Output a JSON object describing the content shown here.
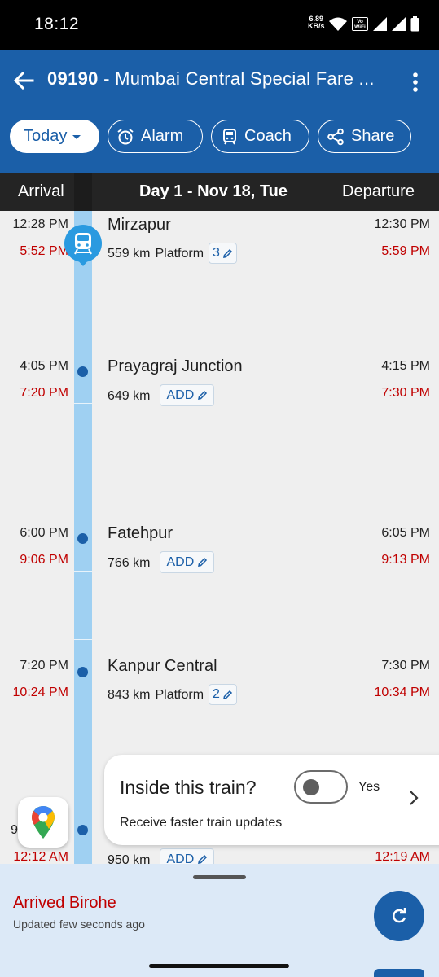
{
  "status_bar": {
    "time": "18:12",
    "speed_value": "6.89",
    "speed_unit": "KB/s",
    "vowifi_label": "Vo WiFi",
    "icons": [
      "wifi-icon",
      "vowifi-icon",
      "signal-icon",
      "battery-icon"
    ]
  },
  "app_bar": {
    "train_number": "09190",
    "title_rest": " - Mumbai Central Special Fare ...",
    "icons": [
      "back-arrow-icon",
      "more-vert-icon"
    ]
  },
  "chips": {
    "today": "Today",
    "alarm": "Alarm",
    "coach": "Coach",
    "share": "Share"
  },
  "header": {
    "arrival": "Arrival",
    "day": "Day 1 - Nov 18, Tue",
    "departure": "Departure"
  },
  "stations": [
    {
      "name": "Mirzapur",
      "km": "559 km",
      "platform_label": "Platform",
      "platform": "3",
      "sched_arr": "12:28 PM",
      "act_arr": "5:52 PM",
      "sched_dep": "12:30 PM",
      "act_dep": "5:59 PM"
    },
    {
      "name": "Prayagraj Junction",
      "km": "649 km",
      "add_label": "ADD",
      "sched_arr": "4:05 PM",
      "act_arr": "7:20 PM",
      "sched_dep": "4:15 PM",
      "act_dep": "7:30 PM"
    },
    {
      "name": "Fatehpur",
      "km": "766 km",
      "add_label": "ADD",
      "sched_arr": "6:00 PM",
      "act_arr": "9:06 PM",
      "sched_dep": "6:05 PM",
      "act_dep": "9:13 PM"
    },
    {
      "name": "Kanpur Central",
      "km": "843 km",
      "platform_label": "Platform",
      "platform": "2",
      "sched_arr": "7:20 PM",
      "act_arr": "10:24 PM",
      "sched_dep": "7:30 PM",
      "act_dep": "10:34 PM"
    },
    {
      "km": "950 km",
      "add_label": "ADD",
      "sched_arr_partial": "9",
      "act_arr": "12:12 AM",
      "act_dep": "12:19 AM"
    }
  ],
  "inside_card": {
    "question": "Inside this train?",
    "subtitle": "Receive faster train updates",
    "toggle_label": "Yes",
    "toggle_on": false
  },
  "bottom_panel": {
    "status": "Arrived Birohe",
    "updated": "Updated few seconds ago"
  },
  "colors": {
    "primary": "#1b5fa8",
    "delay_red": "#c00000",
    "track": "#9fd0f2",
    "header_bg": "#242424",
    "panel_bg": "#dce9f7"
  }
}
